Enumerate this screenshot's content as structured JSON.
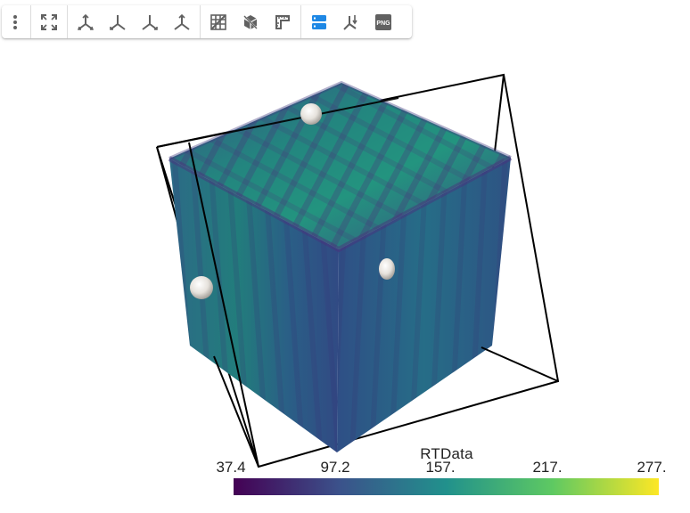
{
  "toolbar": {
    "buttons": [
      {
        "name": "menu",
        "icon": "vertical-dots-icon"
      },
      {
        "name": "reset-camera",
        "icon": "fullscreen-arrows-icon"
      },
      {
        "name": "view-x-plus",
        "icon": "axis-triad-icon"
      },
      {
        "name": "view-x-minus",
        "icon": "axis-triad-icon"
      },
      {
        "name": "view-y-plus",
        "icon": "axis-triad-icon"
      },
      {
        "name": "view-y-minus",
        "icon": "axis-triad-icon"
      },
      {
        "name": "toggle-grid",
        "icon": "grid-icon"
      },
      {
        "name": "toggle-outline",
        "icon": "cube-icon"
      },
      {
        "name": "toggle-ruler",
        "icon": "ruler-icon"
      },
      {
        "name": "toggle-colorbar",
        "icon": "colorbar-icon",
        "active": true
      },
      {
        "name": "orientation-axes",
        "icon": "axes-arrow-icon"
      },
      {
        "name": "screenshot-png",
        "icon": "png-icon",
        "label": "PNG"
      }
    ],
    "active_color": "#1e88e5",
    "icon_color": "#616161"
  },
  "colorbar": {
    "title": "RTData",
    "ticks": [
      "37.4",
      "97.2",
      "157.",
      "217.",
      "277."
    ],
    "colormap": "viridis",
    "stops": [
      "#440154",
      "#3b528b",
      "#21918c",
      "#5ec962",
      "#fde725"
    ]
  }
}
